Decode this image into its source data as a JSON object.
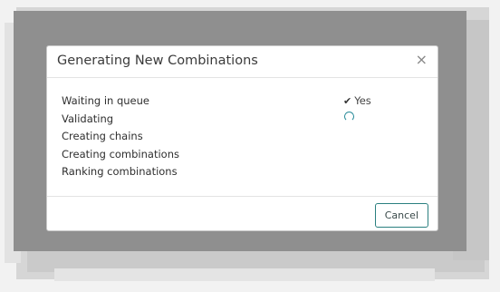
{
  "dialog": {
    "title": "Generating New Combinations",
    "close_symbol": "×",
    "steps": [
      {
        "label": "Waiting in queue",
        "status": "done",
        "status_text": "Yes"
      },
      {
        "label": "Validating",
        "status": "in-progress"
      },
      {
        "label": "Creating chains",
        "status": "pending"
      },
      {
        "label": "Creating combinations",
        "status": "pending"
      },
      {
        "label": "Ranking combinations",
        "status": "pending"
      }
    ],
    "check_symbol": "✔",
    "cancel_label": "Cancel"
  },
  "colors": {
    "accent": "#2a7f7f",
    "spinner": "#2a8c9a"
  }
}
